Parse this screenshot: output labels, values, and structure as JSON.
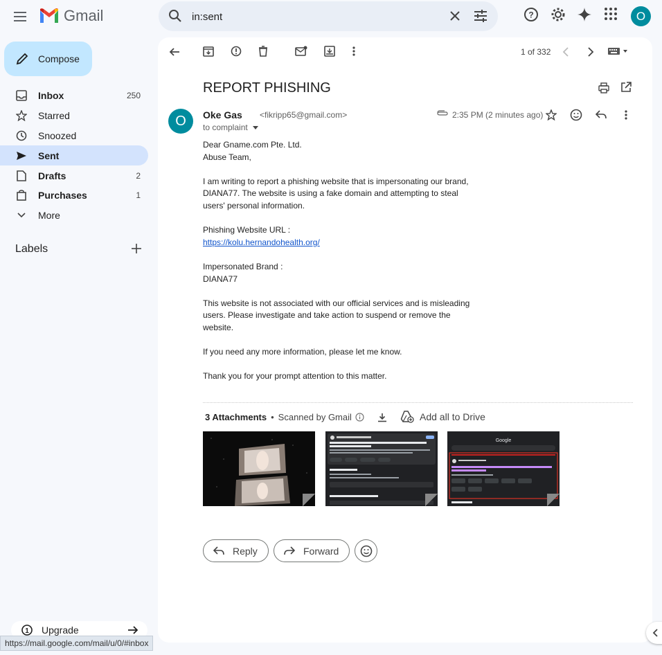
{
  "app": {
    "name": "Gmail"
  },
  "search": {
    "query": "in:sent"
  },
  "account": {
    "initial": "O"
  },
  "sidebar": {
    "compose_label": "Compose",
    "items": [
      {
        "label": "Inbox",
        "count": "250",
        "icon": "inbox-icon"
      },
      {
        "label": "Starred",
        "count": "",
        "icon": "star-icon"
      },
      {
        "label": "Snoozed",
        "count": "",
        "icon": "clock-icon"
      },
      {
        "label": "Sent",
        "count": "",
        "icon": "send-icon"
      },
      {
        "label": "Drafts",
        "count": "2",
        "icon": "draft-icon"
      },
      {
        "label": "Purchases",
        "count": "1",
        "icon": "bag-icon"
      },
      {
        "label": "More",
        "count": "",
        "icon": "chevron-down-icon"
      }
    ],
    "labels_heading": "Labels",
    "upgrade_label": "Upgrade"
  },
  "status_bar_url": "https://mail.google.com/mail/u/0/#inbox",
  "message": {
    "pager": "1 of 332",
    "subject": "REPORT PHISHING",
    "sender_initial": "O",
    "sender_name": "Oke Gas",
    "sender_email": "<fikripp65@gmail.com>",
    "to_line": "to complaint",
    "time": "2:35 PM (2 minutes ago)",
    "greeting_1": "Dear Gname.com Pte. Ltd.",
    "greeting_2": "Abuse Team,",
    "para_1": "I am writing to report a phishing website that is impersonating our brand, DIANA77. The website is using a fake domain and attempting to steal users' personal information.",
    "url_label": "Phishing Website URL :",
    "url": "https://kolu.hernandohealth.org/",
    "brand_label": "Impersonated Brand :",
    "brand": "DIANA77",
    "para_2": "This website is not associated with our official services and is misleading users. Please investigate and take action to suspend or remove the website.",
    "para_3": "If you need any more information, please let me know.",
    "para_4": "Thank you for your prompt attention to this matter."
  },
  "attachments": {
    "count_label": "3 Attachments",
    "scanned_label": "Scanned by Gmail",
    "drive_label": "Add all to Drive"
  },
  "actions": {
    "reply": "Reply",
    "forward": "Forward"
  },
  "colors": {
    "accent": "#c2e7ff",
    "active_nav": "#d3e3fd",
    "avatar": "#008c9e",
    "link": "#1155cc"
  }
}
